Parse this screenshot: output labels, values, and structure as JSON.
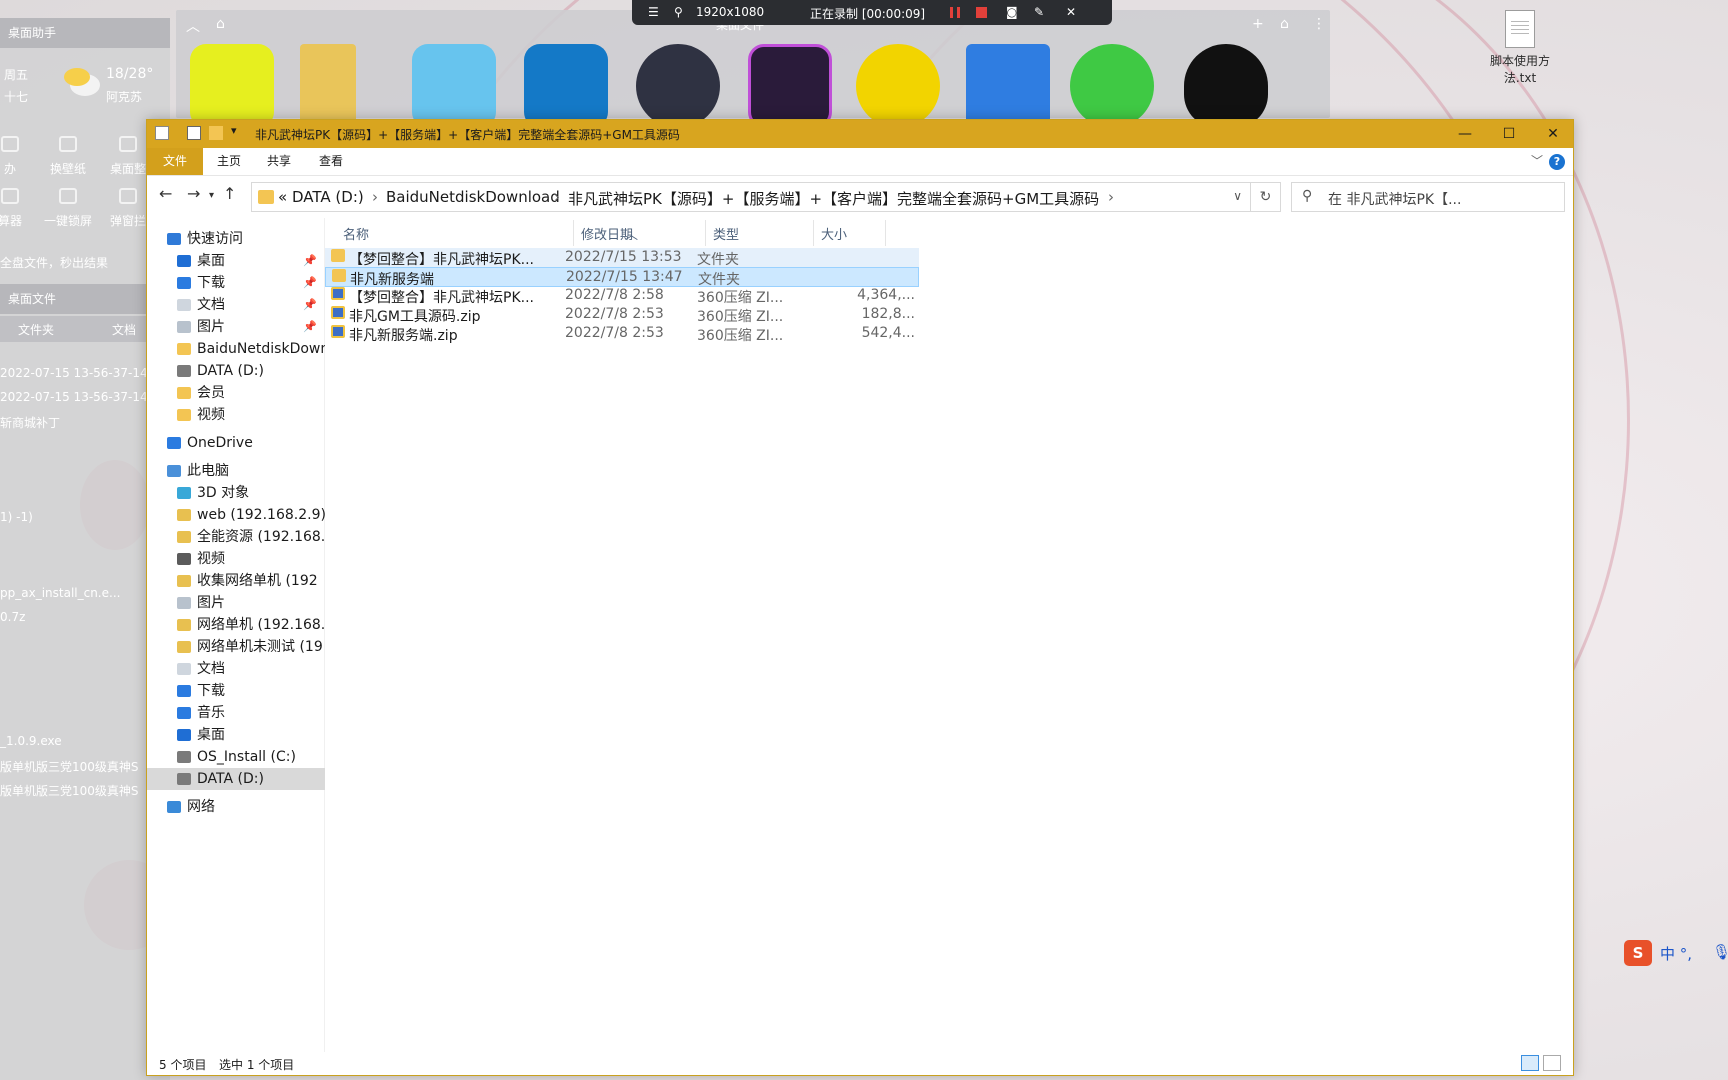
{
  "recorder": {
    "resolution": "1920x1080",
    "status": "正在录制 [00:00:09]"
  },
  "widget": {
    "title": "桌面助手",
    "weekday": "周五",
    "lunar": "十七",
    "temp": "18/28°",
    "city": "阿克苏",
    "tools": [
      {
        "label": "办"
      },
      {
        "label": "换壁纸"
      },
      {
        "label": "桌面整"
      },
      {
        "label": "算器"
      },
      {
        "label": "一键锁屏"
      },
      {
        "label": "弹窗拦"
      }
    ],
    "tip": "全盘文件，秒出结果",
    "files_title": "桌面文件",
    "col_folder": "文件夹",
    "col_doc": "文档",
    "files": [
      "2022-07-15 13-56-37-14...",
      "2022-07-15 13-56-37-14...",
      "斩商城补丁",
      "1) -1)",
      "pp_ax_install_cn.e...",
      "0.7z",
      "_1.0.9.exe",
      "版单机版三党100级真神S",
      "版单机版三党100级真神S"
    ]
  },
  "dock": {
    "label": "桌面文件",
    "apps": [
      "game-icon",
      "folder-icon",
      "live-anime-icon",
      "vmware-icon",
      "electron-icon",
      "editor-icon",
      "music-icon",
      "notes-icon",
      "wechat-icon",
      "qq-icon"
    ]
  },
  "desktop_file": {
    "name": "脚本使用方法.txt"
  },
  "ime": {
    "logo": "S",
    "label": "中 °,"
  },
  "explorer": {
    "title": "非凡武神坛PK【源码】+【服务端】+【客户端】完整端全套源码+GM工具源码",
    "controls": {
      "minimize": "—",
      "maximize": "☐",
      "close": "✕"
    },
    "ribbon_tabs": [
      "文件",
      "主页",
      "共享",
      "查看"
    ],
    "help": "?",
    "breadcrumbs": [
      "DATA (D:)",
      "BaiduNetdiskDownload",
      "非凡武神坛PK【源码】+【服务端】+【客户端】完整端全套源码+GM工具源码"
    ],
    "crumb_prefix": "«",
    "search_placeholder": "在 非凡武神坛PK【...",
    "nav": [
      {
        "label": "快速访问",
        "icon": "star-icon",
        "level": 0
      },
      {
        "label": "桌面",
        "icon": "desktop-icon",
        "level": 1,
        "pinned": true
      },
      {
        "label": "下载",
        "icon": "download-icon",
        "level": 1,
        "pinned": true
      },
      {
        "label": "文档",
        "icon": "document-icon",
        "level": 1,
        "pinned": true
      },
      {
        "label": "图片",
        "icon": "picture-icon",
        "level": 1,
        "pinned": true
      },
      {
        "label": "BaiduNetdiskDownload",
        "icon": "folder-icon",
        "level": 1
      },
      {
        "label": "DATA (D:)",
        "icon": "drive-icon",
        "level": 1
      },
      {
        "label": "会员",
        "icon": "folder-icon",
        "level": 1
      },
      {
        "label": "视频",
        "icon": "folder-icon",
        "level": 1
      },
      {
        "label": "OneDrive",
        "icon": "cloud-icon",
        "level": 0
      },
      {
        "label": "此电脑",
        "icon": "computer-icon",
        "level": 0
      },
      {
        "label": "3D 对象",
        "icon": "3d-icon",
        "level": 1
      },
      {
        "label": "web (192.168.2.9)",
        "icon": "network-folder-icon",
        "level": 1
      },
      {
        "label": "全能资源 (192.168.",
        "icon": "network-folder-icon",
        "level": 1
      },
      {
        "label": "视频",
        "icon": "video-icon",
        "level": 1
      },
      {
        "label": "收集网络单机 (192",
        "icon": "network-folder-icon",
        "level": 1
      },
      {
        "label": "图片",
        "icon": "picture-icon",
        "level": 1
      },
      {
        "label": "网络单机 (192.168.",
        "icon": "network-folder-icon",
        "level": 1
      },
      {
        "label": "网络单机未测试 (19",
        "icon": "network-folder-icon",
        "level": 1
      },
      {
        "label": "文档",
        "icon": "document-icon",
        "level": 1
      },
      {
        "label": "下载",
        "icon": "download-icon",
        "level": 1
      },
      {
        "label": "音乐",
        "icon": "music-icon",
        "level": 1
      },
      {
        "label": "桌面",
        "icon": "desktop-icon",
        "level": 1
      },
      {
        "label": "OS_Install (C:)",
        "icon": "drive-icon",
        "level": 1
      },
      {
        "label": "DATA (D:)",
        "icon": "drive-icon",
        "level": 1,
        "selected": true
      },
      {
        "label": "网络",
        "icon": "network-icon",
        "level": 0
      }
    ],
    "columns": [
      "名称",
      "修改日期",
      "类型",
      "大小"
    ],
    "files": [
      {
        "name": "【梦回整合】非凡武神坛PK...",
        "date": "2022/7/15 13:53",
        "type": "文件夹",
        "size": "",
        "kind": "folder",
        "state": "hover"
      },
      {
        "name": "非凡新服务端",
        "date": "2022/7/15 13:47",
        "type": "文件夹",
        "size": "",
        "kind": "folder",
        "state": "selected"
      },
      {
        "name": "【梦回整合】非凡武神坛PK...",
        "date": "2022/7/8 2:58",
        "type": "360压缩 ZI...",
        "size": "4,364,...",
        "kind": "zip",
        "state": ""
      },
      {
        "name": "非凡GM工具源码.zip",
        "date": "2022/7/8 2:53",
        "type": "360压缩 ZI...",
        "size": "182,8...",
        "kind": "zip",
        "state": ""
      },
      {
        "name": "非凡新服务端.zip",
        "date": "2022/7/8 2:53",
        "type": "360压缩 ZI...",
        "size": "542,4...",
        "kind": "zip",
        "state": ""
      }
    ],
    "status_count": "5 个项目",
    "status_selected": "选中 1 个项目"
  },
  "colors": {
    "accent": "#d8a51f",
    "selection": "#cce8ff",
    "hover": "#e5f0fb"
  }
}
